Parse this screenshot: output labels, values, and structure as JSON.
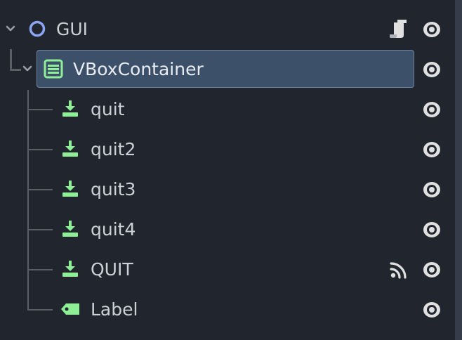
{
  "scene_tree": {
    "root": {
      "label": "GUI",
      "has_script": true,
      "visible": true
    },
    "container": {
      "label": "VBoxContainer",
      "visible": true,
      "selected": true
    },
    "children": [
      {
        "label": "quit",
        "type": "button",
        "visible": true,
        "has_signal": false
      },
      {
        "label": "quit2",
        "type": "button",
        "visible": true,
        "has_signal": false
      },
      {
        "label": "quit3",
        "type": "button",
        "visible": true,
        "has_signal": false
      },
      {
        "label": "quit4",
        "type": "button",
        "visible": true,
        "has_signal": false
      },
      {
        "label": "QUIT",
        "type": "button",
        "visible": true,
        "has_signal": true
      },
      {
        "label": "Label",
        "type": "label",
        "visible": true,
        "has_signal": false
      }
    ]
  },
  "icons": {
    "root": "circle-control-icon",
    "container": "vbox-container-icon",
    "button": "button-node-icon",
    "label": "label-node-icon",
    "script": "script-icon",
    "signal": "signal-icon",
    "visibility": "eye-icon"
  },
  "colors": {
    "background": "#21262e",
    "selection": "#3d506a",
    "selection_border": "#6e839f",
    "text": "#cdd0d4",
    "node_green": "#8eef97",
    "control_blue": "#8da5f3",
    "icon_gray": "#e0e0e0"
  }
}
